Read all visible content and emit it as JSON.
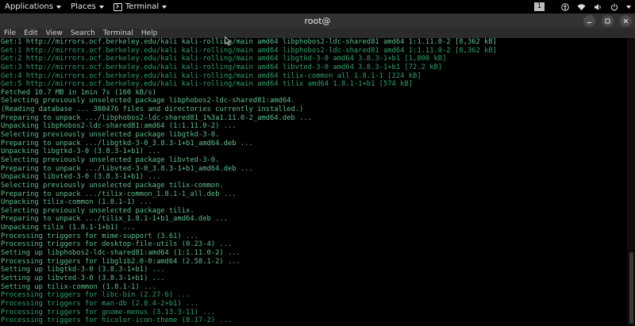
{
  "topbar": {
    "applications_label": "Applications",
    "places_label": "Places",
    "terminal_label": "Terminal",
    "workspace_number": "1"
  },
  "window": {
    "title": "root@"
  },
  "menubar": {
    "items": [
      "File",
      "Edit",
      "View",
      "Search",
      "Terminal",
      "Help"
    ]
  },
  "colors": {
    "text_primary": "#5fbf8f",
    "text_secondary": "#2fa06a",
    "background": "#000000"
  },
  "terminal": {
    "lines": [
      "Get:1 http://mirrors.ocf.berkeley.edu/kali kali-rolling/main amd64 libphobos2-ldc-shared81 amd64 1:1.11.0-2 [8,362 kB]",
      "Get:1 http://mirrors.ocf.berkeley.edu/kali kali-rolling/main amd64 libphobos2-ldc-shared81 amd64 1:1.11.0-2 [8,362 kB]",
      "Get:2 http://mirrors.ocf.berkeley.edu/kali kali-rolling/main amd64 libgtkd-3-0 amd64 3.8.3-1+b1 [1,800 kB]",
      "Get:3 http://mirrors.ocf.berkeley.edu/kali kali-rolling/main amd64 libvted-3-0 amd64 3.8.3-1+b1 [72.2 kB]",
      "Get:4 http://mirrors.ocf.berkeley.edu/kali kali-rolling/main amd64 tilix-common all 1.8.1-1 [224 kB]",
      "Get:5 http://mirrors.ocf.berkeley.edu/kali kali-rolling/main amd64 tilix amd64 1.8.1-1+b1 [574 kB]",
      "Fetched 10.7 MB in 1min 7s (160 kB/s)",
      "Selecting previously unselected package libphobos2-ldc-shared81:amd64.",
      "(Reading database ... 380476 files and directories currently installed.)",
      "Preparing to unpack .../libphobos2-ldc-shared81_1%3a1.11.0-2_amd64.deb ...",
      "Unpacking libphobos2-ldc-shared81:amd64 (1:1.11.0-2) ...",
      "Selecting previously unselected package libgtkd-3-0.",
      "Preparing to unpack .../libgtkd-3-0_3.8.3-1+b1_amd64.deb ...",
      "Unpacking libgtkd-3-0 (3.8.3-1+b1) ...",
      "Selecting previously unselected package libvted-3-0.",
      "Preparing to unpack .../libvted-3-0_3.8.3-1+b1_amd64.deb ...",
      "Unpacking libvted-3-0 (3.8.3-1+b1) ...",
      "Selecting previously unselected package tilix-common.",
      "Preparing to unpack .../tilix-common_1.8.1-1_all.deb ...",
      "Unpacking tilix-common (1.8.1-1) ...",
      "Selecting previously unselected package tilix.",
      "Preparing to unpack .../tilix_1.8.1-1+b1_amd64.deb ...",
      "Unpacking tilix (1.8.1-1+b1) ...",
      "Processing triggers for mime-support (3.61) ...",
      "Processing triggers for desktop-file-utils (0.23-4) ...",
      "Setting up libphobos2-ldc-shared81:amd64 (1:1.11.0-2) ...",
      "Processing triggers for libglib2.0-0:amd64 (2.58.1-2) ...",
      "Setting up libgtkd-3-0 (3.8.3-1+b1) ...",
      "Setting up libvted-3-0 (3.8.3-1+b1) ...",
      "Setting up tilix-common (1.8.1-1) ...",
      "Processing triggers for libc-bin (2.27-6) ...",
      "Processing triggers for man-db (2.8.4-2+b1) ...",
      "Processing triggers for gnome-menus (3.13.3-11) ...",
      "Processing triggers for hicolor-icon-theme (0.17-2) ..."
    ],
    "dim_lines": [
      1,
      2,
      3,
      4,
      5,
      30,
      31,
      32,
      33
    ]
  },
  "icons": {
    "workspace_indicator": "workspace-indicator",
    "accessibility": "accessibility-icon",
    "network": "wifi-icon",
    "volume": "speaker-icon",
    "power": "power-icon",
    "mouse_cursor": "mouse-cursor-icon"
  }
}
